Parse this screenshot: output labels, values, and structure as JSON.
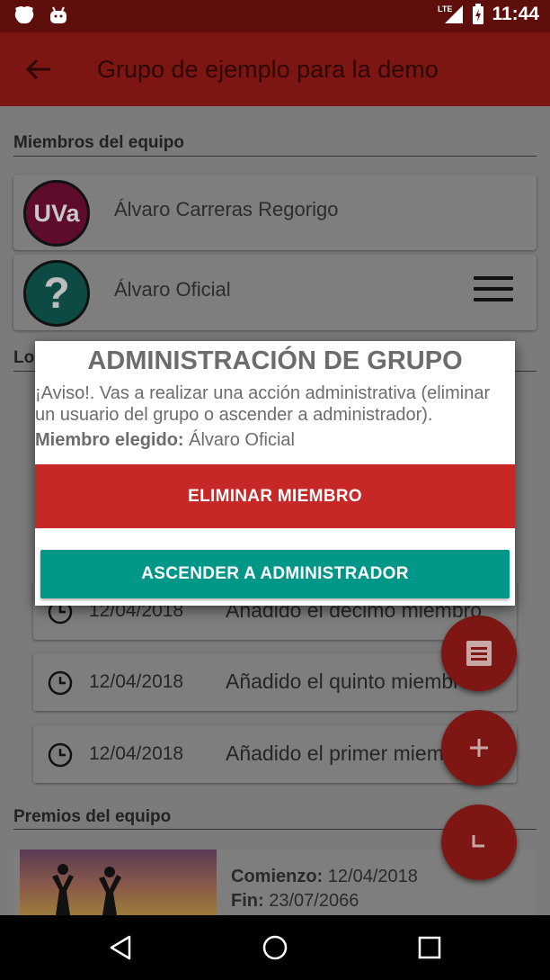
{
  "status_bar": {
    "time": "11:44",
    "network": "LTE",
    "icons": [
      "app-notification-icon",
      "android-notification-icon",
      "lte-signal-icon",
      "battery-charging-icon"
    ]
  },
  "app_bar": {
    "title": "Grupo de ejemplo para la demo",
    "back_icon": "arrow-left-icon"
  },
  "members_section": {
    "title": "Miembros del equipo",
    "members": [
      {
        "name": "Álvaro Carreras Regorigo",
        "avatar_text": "UVa"
      },
      {
        "name": "Álvaro Oficial",
        "avatar_text": "?"
      }
    ]
  },
  "logs_section": {
    "title_visible_fragment": "Lo",
    "events": [
      {
        "date": "12/04/2018",
        "text": "Añadido el décimo miembro"
      },
      {
        "date": "12/04/2018",
        "text": "Añadido el quinto miembro"
      },
      {
        "date": "12/04/2018",
        "text": "Añadido el primer miembro"
      }
    ]
  },
  "prizes_section": {
    "title": "Premios del equipo",
    "prize": {
      "start_label": "Comienzo:",
      "start_value": "12/04/2018",
      "end_label": "Fin:",
      "end_value": "23/07/2066"
    }
  },
  "dialog": {
    "title": "ADMINISTRACIÓN DE GRUPO",
    "message": "¡Aviso!. Vas a realizar una acción administrativa (eliminar un usuario del grupo o ascender a administrador).",
    "member_label": "Miembro elegido:",
    "member_value": "Álvaro Oficial",
    "delete_button": "ELIMINAR MIEMBRO",
    "promote_button": "ASCENDER A ADMINISTRADOR"
  },
  "fabs": [
    "list-icon",
    "plus-icon",
    "corner-icon"
  ],
  "colors": {
    "primary": "#c62828",
    "accent": "#009688",
    "dialog_text": "#6c6c6c"
  }
}
